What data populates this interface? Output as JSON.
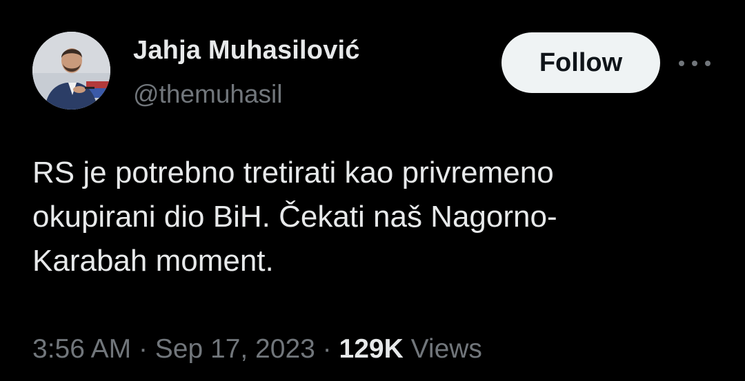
{
  "author": {
    "name": "Jahja Muhasilović",
    "handle": "@themuhasil"
  },
  "actions": {
    "follow_label": "Follow"
  },
  "tweet": {
    "lines": [
      "RS je potrebno tretirati kao privremeno",
      "okupirani dio BiH. Čekati naš Nagorno-",
      "Karabah moment."
    ]
  },
  "meta": {
    "time": "3:56 AM",
    "separator": "·",
    "date": "Sep 17, 2023",
    "views_count": "129K",
    "views_label": "Views"
  },
  "icons": {
    "more": "more-horizontal-icon",
    "avatar": "profile-photo"
  },
  "colors": {
    "background": "#000000",
    "text_primary": "#e7e9ea",
    "text_secondary": "#71767b",
    "follow_bg": "#eff3f4",
    "follow_text": "#0f1419"
  }
}
